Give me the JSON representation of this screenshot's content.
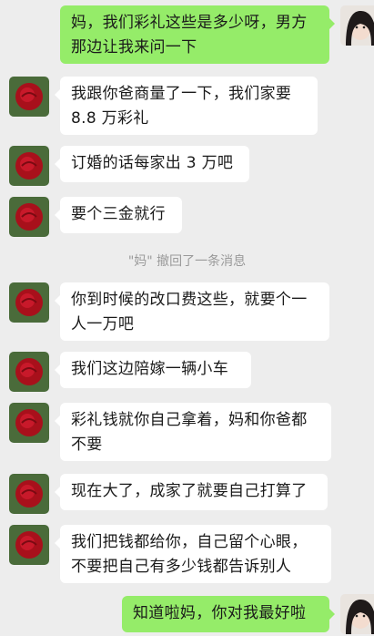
{
  "messages": [
    {
      "side": "right",
      "lines": [
        "妈，我们彩礼这些是多少呀，男方",
        "那边让我来问一下"
      ]
    },
    {
      "side": "left",
      "lines": [
        "我跟你爸商量了一下，我们家要",
        "8.8 万彩礼"
      ]
    },
    {
      "side": "left",
      "lines": [
        "订婚的话每家出 3 万吧"
      ]
    },
    {
      "side": "left",
      "lines": [
        "要个三金就行"
      ]
    },
    {
      "side": "left",
      "lines": [
        "你到时候的改口费这些，就要个一",
        "人一万吧"
      ]
    },
    {
      "side": "left",
      "lines": [
        "我们这边陪嫁一辆小车"
      ]
    },
    {
      "side": "left",
      "lines": [
        "彩礼钱就你自己拿着，妈和你爸都",
        "不要"
      ]
    },
    {
      "side": "left",
      "lines": [
        "现在大了，成家了就要自己打算了"
      ]
    },
    {
      "side": "left",
      "lines": [
        "我们把钱都给你，自己留个心眼，",
        "不要把自己有多少钱都告诉别人"
      ]
    },
    {
      "side": "right",
      "lines": [
        "知道啦妈，你对我最好啦"
      ]
    }
  ],
  "system_notice": "\"妈\" 撤回了一条消息",
  "colors": {
    "background": "#ededed",
    "sent_bubble": "#95ec69",
    "received_bubble": "#ffffff"
  }
}
